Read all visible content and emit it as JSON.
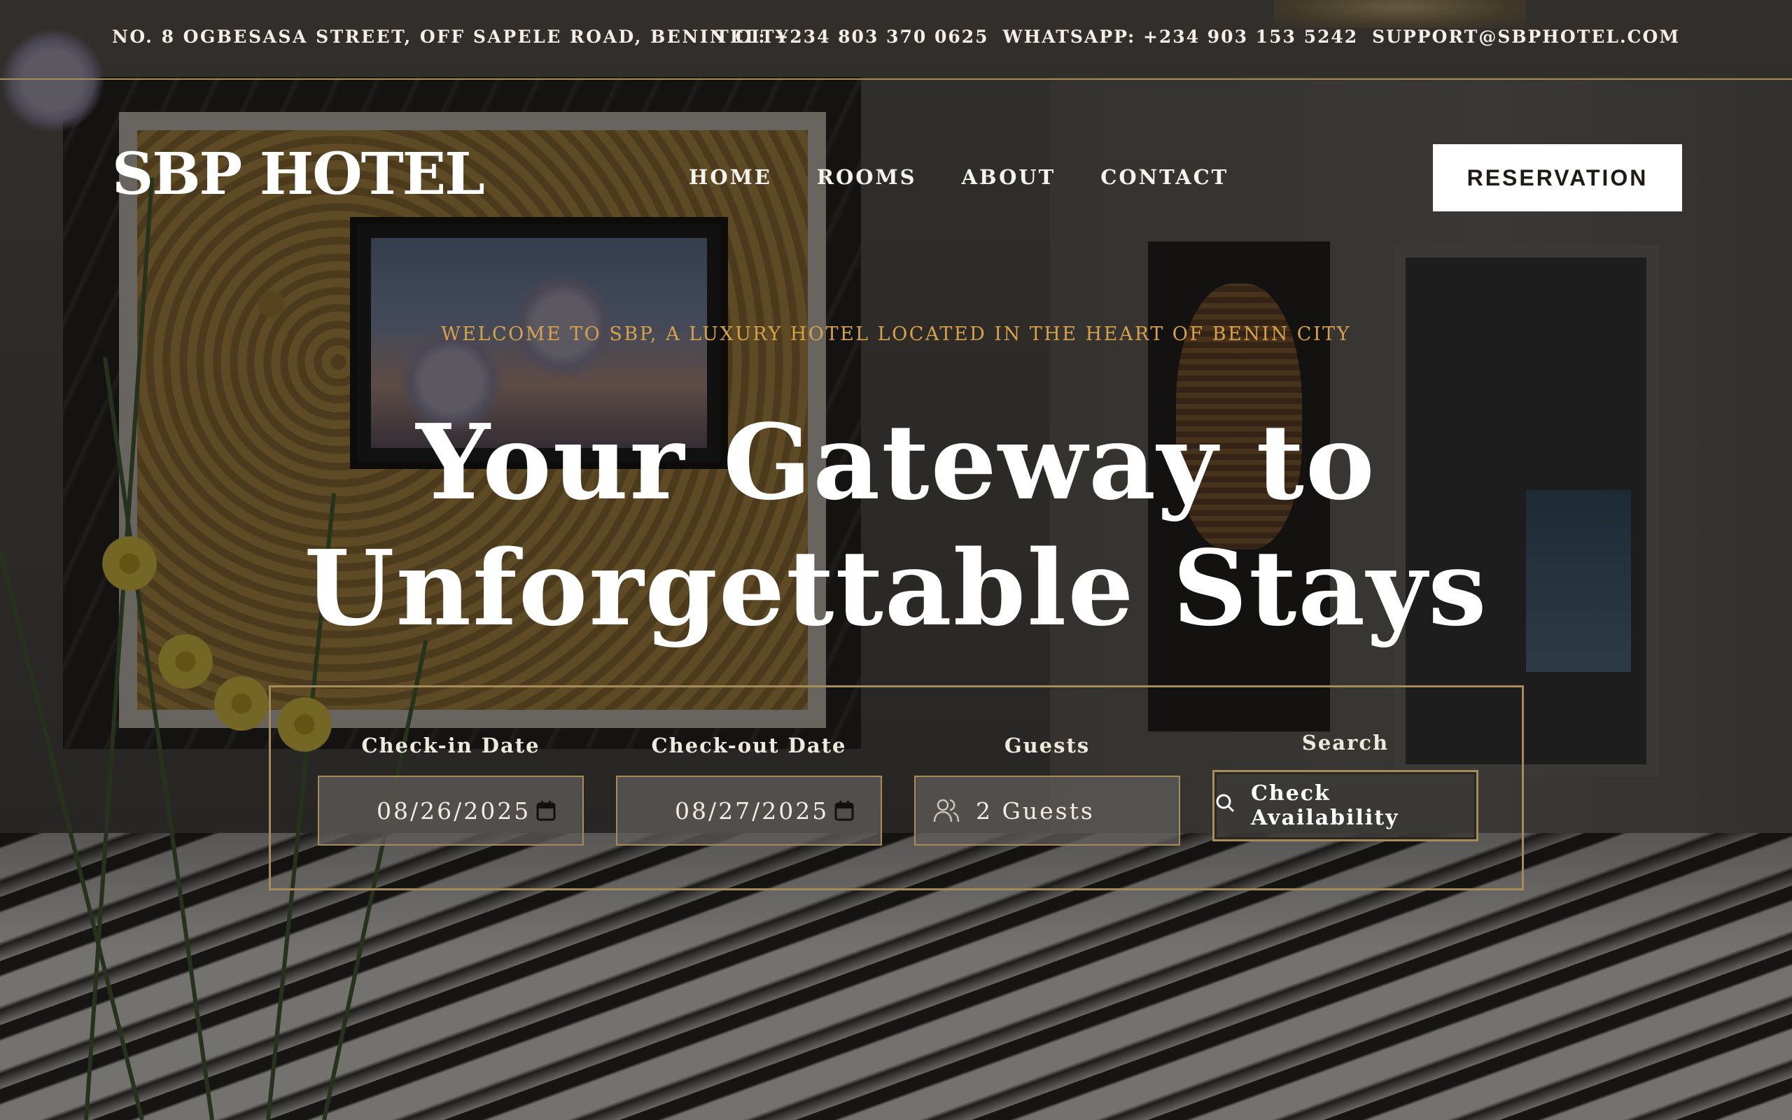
{
  "topbar": {
    "address": "NO. 8 OGBESASA STREET, OFF SAPELE ROAD, BENIN CITY",
    "tel": "TEL: +234 803 370 0625",
    "whatsapp": "WHATSAPP: +234 903 153 5242",
    "email": "SUPPORT@SBPHOTEL.COM"
  },
  "header": {
    "logo": "SBP HOTEL",
    "nav": [
      "HOME",
      "ROOMS",
      "ABOUT",
      "CONTACT"
    ],
    "reservation_label": "RESERVATION"
  },
  "hero": {
    "tagline": "WELCOME TO SBP, A LUXURY HOTEL LOCATED IN THE HEART OF BENIN CITY",
    "title_line1": "Your Gateway to",
    "title_line2": "Unforgettable Stays"
  },
  "booking": {
    "checkin_label": "Check-in Date",
    "checkin_value": "08/26/2025",
    "checkout_label": "Check-out Date",
    "checkout_value": "08/27/2025",
    "guests_label": "Guests",
    "guests_value": "2 Guests",
    "search_label": "Search",
    "search_button": "Check Availability"
  },
  "icons": {
    "calendar": "calendar-icon",
    "guests": "users-icon",
    "search": "search-icon"
  },
  "colors": {
    "accent_gold": "#d6a24a",
    "border_gold": "#a88b5a",
    "button_bg": "#ffffff"
  }
}
